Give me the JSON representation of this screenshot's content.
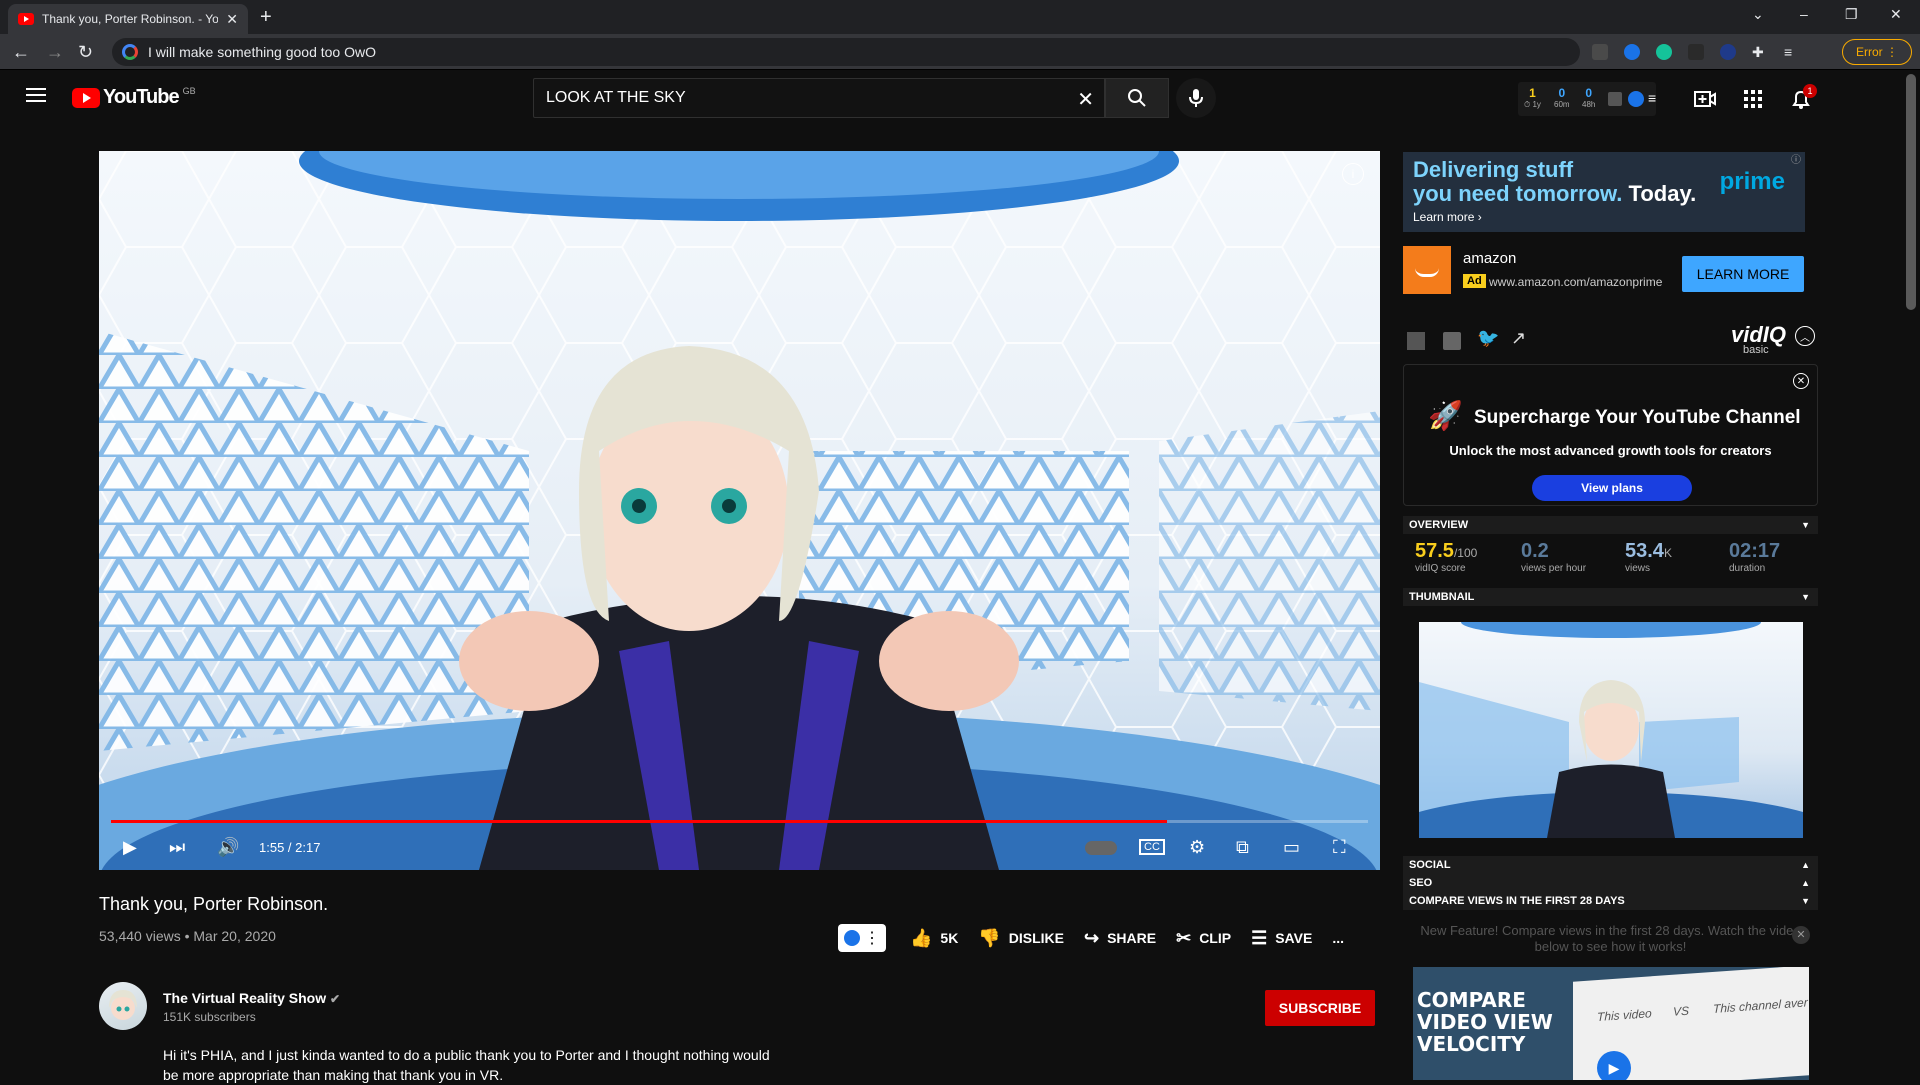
{
  "browser": {
    "tab_title": "Thank you, Porter Robinson. - YouTube",
    "new_tab": "+",
    "url_text": "I will make something good too OwO",
    "error_label": "Error"
  },
  "youtube": {
    "logo": "YouTube",
    "region": "GB",
    "search_value": "LOOK AT THE SKY",
    "vidiq_stats": [
      {
        "value": "1",
        "label": "⏱ 1y"
      },
      {
        "value": "0",
        "label": "60m"
      },
      {
        "value": "0",
        "label": "48h"
      }
    ],
    "notification_count": "1"
  },
  "player": {
    "time": "1:55 / 2:17",
    "progress": 0.84,
    "info": "i"
  },
  "video": {
    "title": "Thank you, Porter Robinson.",
    "meta": "53,440 views • Mar 20, 2020",
    "likes": "5K",
    "dislike": "DISLIKE",
    "share": "SHARE",
    "clip": "CLIP",
    "save": "SAVE",
    "more": "..."
  },
  "channel": {
    "name": "The Virtual Reality Show",
    "subs": "151K subscribers",
    "subscribe": "SUBSCRIBE",
    "description": "Hi it's PHIA, and I just kinda wanted to do a public thank you to Porter and I thought nothing would be more appropriate than making that thank you in VR."
  },
  "ad": {
    "line1a": "Delivering stuff",
    "line1b": "you need tomorrow.",
    "line1c": "Today.",
    "learn_more_link": "Learn more ›",
    "prime": "prime",
    "advertiser": "amazon",
    "tag": "Ad",
    "url": "www.amazon.com/amazonprime",
    "cta": "LEARN MORE"
  },
  "vidiq": {
    "logo": "vidIQ",
    "plan": "basic",
    "promo_title": "Supercharge Your YouTube Channel",
    "promo_sub": "Unlock the most advanced growth tools for creators",
    "promo_cta": "View plans",
    "sections": {
      "overview": "OVERVIEW",
      "thumbnail": "THUMBNAIL",
      "social": "SOCIAL",
      "seo": "SEO",
      "compare": "COMPARE VIEWS IN THE FIRST 28 DAYS"
    },
    "overview": {
      "score": "57.5",
      "score_max": "/100",
      "score_label": "vidIQ score",
      "vph": "0.2",
      "vph_label": "views per hour",
      "views": "53.4",
      "views_unit": "K",
      "views_label": "views",
      "duration": "02:17",
      "duration_label": "duration"
    },
    "new_feature": "New Feature! Compare views in the first 28 days. Watch the video below to see how it works!",
    "cv_title": "COMPARE VIDEO VIEW VELOCITY",
    "cv_this_video": "This video",
    "cv_vs": "VS",
    "cv_channel": "This channel aver"
  },
  "colors": {
    "yt_red": "#ff0000",
    "subscribe_red": "#cc0000",
    "learn_more_blue": "#3ea6ff",
    "vidiq_blue": "#1a3fe0",
    "amazon_orange": "#f47c1b"
  }
}
